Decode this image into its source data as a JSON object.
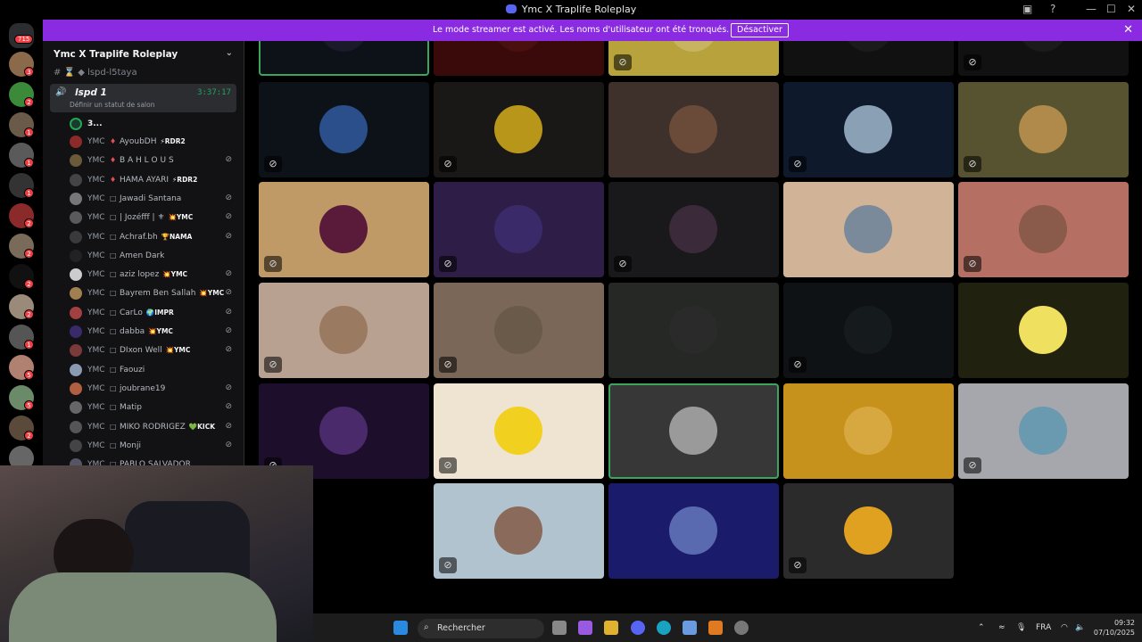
{
  "titlebar": {
    "title": "Ymc X Traplife Roleplay",
    "min": "—",
    "max": "☐",
    "close": "✕"
  },
  "banner": {
    "message": "Le mode streamer est activé. Les noms d'utilisateur ont été tronqués.",
    "button": "Désactiver"
  },
  "rail": {
    "dm_badge": "715",
    "badges": [
      "3",
      "2",
      "1",
      "1",
      "1",
      "2",
      "2",
      "2",
      "2",
      "1",
      "5",
      "5",
      "2"
    ]
  },
  "sidebar": {
    "server_name": "Ymc X Traplife Roleplay",
    "channel_above": "lspd-l5taya",
    "voice_channel": {
      "name": "lspd 1",
      "timer": "3:37:17",
      "status": "Définir un statut de salon"
    },
    "first_member": "3...",
    "members": [
      {
        "prefix": "YMC",
        "sym": "♦",
        "name": "AyoubDH",
        "tag": "⚡RDR2",
        "muted": false,
        "color": "#8b2a2a"
      },
      {
        "prefix": "YMC",
        "sym": "♦",
        "name": "B A H L O U S",
        "tag": "",
        "muted": true,
        "color": "#6b5a3a"
      },
      {
        "prefix": "YMC",
        "sym": "♦",
        "name": "HAMA AYARI",
        "tag": "⚡RDR2",
        "muted": false,
        "color": "#444"
      },
      {
        "prefix": "YMC",
        "sym": "□",
        "name": "Jawadi Santana",
        "tag": "",
        "muted": true,
        "color": "#777"
      },
      {
        "prefix": "YMC",
        "sym": "□",
        "name": "| Jozéfff | ⚜",
        "tag": "💥YMC",
        "muted": true,
        "color": "#5a5a5a"
      },
      {
        "prefix": "YMC",
        "sym": "□",
        "name": "Achraf.bh",
        "tag": "🏆NAMA",
        "muted": true,
        "color": "#3a3a3a"
      },
      {
        "prefix": "YMC",
        "sym": "□",
        "name": "Amen Dark",
        "tag": "",
        "muted": false,
        "color": "#222"
      },
      {
        "prefix": "YMC",
        "sym": "□",
        "name": "aziz lopez",
        "tag": "💥YMC",
        "muted": true,
        "color": "#ccc"
      },
      {
        "prefix": "YMC",
        "sym": "□",
        "name": "Bayrem Ben Sallah",
        "tag": "💥YMC",
        "muted": true,
        "color": "#a08050"
      },
      {
        "prefix": "YMC",
        "sym": "□",
        "name": "CarLo",
        "tag": "🌍IMPR",
        "muted": true,
        "color": "#a04040"
      },
      {
        "prefix": "YMC",
        "sym": "□",
        "name": "dabba",
        "tag": "💥YMC",
        "muted": true,
        "color": "#3a2a6a"
      },
      {
        "prefix": "YMC",
        "sym": "□",
        "name": "DIxon Well",
        "tag": "💥YMC",
        "muted": true,
        "color": "#7a3a3a"
      },
      {
        "prefix": "YMC",
        "sym": "□",
        "name": "Faouzi",
        "tag": "",
        "muted": false,
        "color": "#8a9ab0"
      },
      {
        "prefix": "YMC",
        "sym": "□",
        "name": "joubrane19",
        "tag": "",
        "muted": true,
        "color": "#b06040"
      },
      {
        "prefix": "YMC",
        "sym": "□",
        "name": "Matip",
        "tag": "",
        "muted": true,
        "color": "#666"
      },
      {
        "prefix": "YMC",
        "sym": "□",
        "name": "MIKO RODRIGEZ",
        "tag": "💚KICK",
        "muted": true,
        "color": "#555"
      },
      {
        "prefix": "YMC",
        "sym": "□",
        "name": "Monji",
        "tag": "",
        "muted": true,
        "color": "#444"
      },
      {
        "prefix": "YMC",
        "sym": "□",
        "name": "PABLO SALVADOR",
        "tag": "",
        "muted": false,
        "color": "#556"
      }
    ]
  },
  "tiles": [
    {
      "bg": "#0d1118",
      "av": "#1a1a2a",
      "mic": false,
      "speak": true
    },
    {
      "bg": "#3a0a0a",
      "av": "#4a1010",
      "mic": false,
      "speak": false
    },
    {
      "bg": "#b7a23c",
      "av": "#c8b460",
      "mic": true,
      "speak": false
    },
    {
      "bg": "#111",
      "av": "#1b1b1b",
      "mic": false,
      "speak": false
    },
    {
      "bg": "#111",
      "av": "#1b1b1b",
      "mic": true,
      "speak": false
    },
    {
      "bg": "#0d1118",
      "av": "#2a4f8a",
      "mic": true,
      "speak": false
    },
    {
      "bg": "#1a1816",
      "av": "#b8961a",
      "mic": true,
      "speak": false
    },
    {
      "bg": "#3e302b",
      "av": "#6a4a38",
      "mic": false,
      "speak": false
    },
    {
      "bg": "#0e1a2b",
      "av": "#8aa0b5",
      "mic": true,
      "speak": false
    },
    {
      "bg": "#57522f",
      "av": "#b08a4a",
      "mic": true,
      "speak": false
    },
    {
      "bg": "#c09a66",
      "av": "#5a1a3a",
      "mic": true,
      "speak": false
    },
    {
      "bg": "#2e1d47",
      "av": "#3a2a6a",
      "mic": true,
      "speak": false
    },
    {
      "bg": "#19191b",
      "av": "#3a2a3a",
      "mic": true,
      "speak": false
    },
    {
      "bg": "#d1b398",
      "av": "#7a8a9a",
      "mic": false,
      "speak": false
    },
    {
      "bg": "#b56f63",
      "av": "#8a5a4a",
      "mic": true,
      "speak": false
    },
    {
      "bg": "#b8a191",
      "av": "#9a7a60",
      "mic": true,
      "speak": false
    },
    {
      "bg": "#7a6757",
      "av": "#6a5a4a",
      "mic": true,
      "speak": false
    },
    {
      "bg": "#262826",
      "av": "#2a2a2a",
      "mic": false,
      "speak": false
    },
    {
      "bg": "#0f1214",
      "av": "#151a1c",
      "mic": true,
      "speak": false
    },
    {
      "bg": "#21210f",
      "av": "#f0e060",
      "mic": false,
      "speak": false
    },
    {
      "bg": "#1d0f2b",
      "av": "#4a2a6a",
      "mic": true,
      "speak": false
    },
    {
      "bg": "#efe4d2",
      "av": "#f2d020",
      "mic": true,
      "speak": false
    },
    {
      "bg": "#373737",
      "av": "#9a9a9a",
      "mic": false,
      "speak": true
    },
    {
      "bg": "#c7921c",
      "av": "#d8a840",
      "mic": false,
      "speak": false
    },
    {
      "bg": "#a6a6ad",
      "av": "#6a9ab0",
      "mic": true,
      "speak": false
    },
    null,
    {
      "bg": "#b2c3d0",
      "av": "#8a6a5a",
      "mic": true,
      "speak": false
    },
    {
      "bg": "#1b1b6b",
      "av": "#5a6ab0",
      "mic": false,
      "speak": false
    },
    {
      "bg": "#2b2b2b",
      "av": "#e0a020",
      "mic": true,
      "speak": false
    }
  ],
  "taskbar": {
    "search": "Rechercher",
    "lang": "FRA",
    "time": "09:32",
    "date": "07/10/2025"
  }
}
